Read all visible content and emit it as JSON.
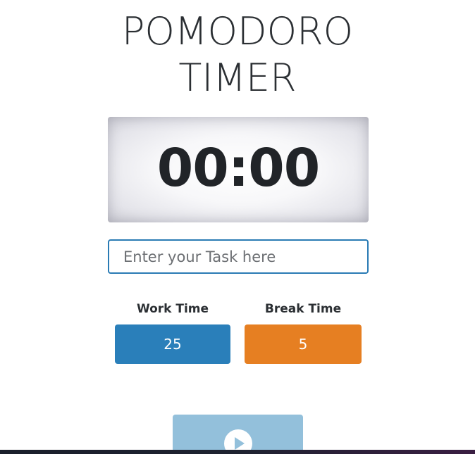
{
  "header": {
    "title_line1": "POMODORO",
    "title_line2": "TIMER"
  },
  "timer": {
    "display": "00:00"
  },
  "task": {
    "placeholder": "Enter your Task here",
    "value": ""
  },
  "settings": {
    "work_label": "Work Time",
    "work_value": "25",
    "break_label": "Break Time",
    "break_value": "5"
  },
  "controls": {
    "play_icon": "play-icon"
  },
  "colors": {
    "work": "#2a7fba",
    "break": "#e67f22",
    "play_button": "#93c0db",
    "input_border": "#2a7bb4"
  }
}
